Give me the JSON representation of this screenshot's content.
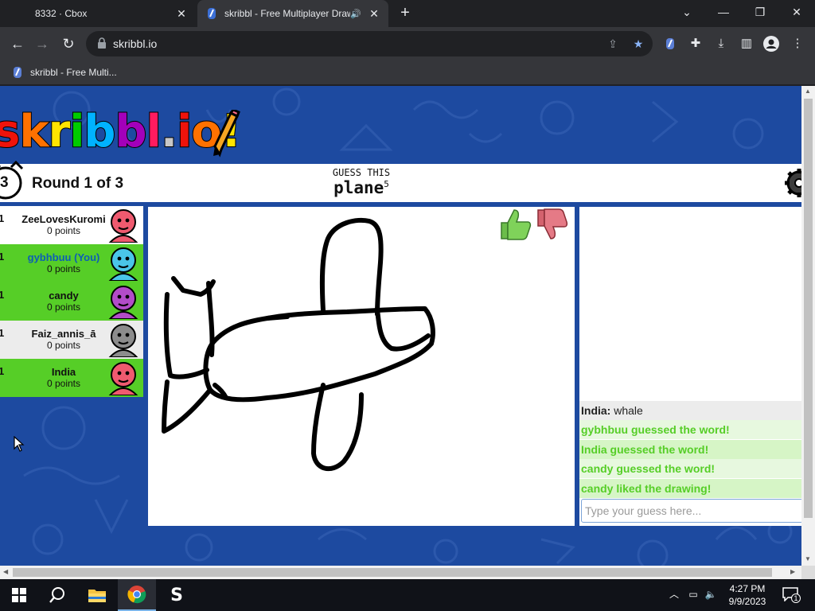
{
  "browser": {
    "tabs": [
      {
        "title": "8332 · Cbox",
        "active": false
      },
      {
        "title": "skribbl - Free Multiplayer Drawing",
        "active": true
      }
    ],
    "url": "skribbl.io",
    "bookmarks": [
      {
        "label": "skribbl - Free Multi..."
      }
    ]
  },
  "game": {
    "logo_letters": [
      "s",
      "k",
      "r",
      "i",
      "b",
      "b",
      "l",
      ".",
      "i",
      "o",
      "!"
    ],
    "logo_colors": [
      "#ef130b",
      "#ff7100",
      "#ffe400",
      "#00cc00",
      "#00b2ff",
      "#a300ba",
      "#ff1b5f",
      "#c7c7c7",
      "#ef130b",
      "#ff7100",
      "#ffe400"
    ],
    "timer": "3",
    "round_label": "Round 1 of 3",
    "guess_label": "GUESS THIS",
    "word": "plane",
    "word_length": "5"
  },
  "players": [
    {
      "rank": "1",
      "name": "ZeeLovesKuromi",
      "points": "0 points",
      "highlight": false,
      "bg": "#ffffff",
      "avatar_color": "#ef5a6f"
    },
    {
      "rank": "1",
      "name": "gybhbuu (You)",
      "points": "0 points",
      "highlight": true,
      "bg": "#56ce27",
      "avatar_color": "#4ac5e8"
    },
    {
      "rank": "1",
      "name": "candy",
      "points": "0 points",
      "highlight": true,
      "bg": "#56ce27",
      "avatar_color": "#b24cc8"
    },
    {
      "rank": "1",
      "name": "Faiz_annis_ā",
      "points": "0 points",
      "highlight": false,
      "bg": "#ececec",
      "avatar_color": "#8c8c8c"
    },
    {
      "rank": "1",
      "name": "India",
      "points": "0 points",
      "highlight": true,
      "bg": "#56ce27",
      "avatar_color": "#ef5a6f"
    }
  ],
  "chat": {
    "messages": [
      {
        "type": "plain",
        "author": "India:",
        "text": " whale"
      },
      {
        "type": "success",
        "author": "",
        "text": "gybhbuu guessed the word!"
      },
      {
        "type": "success",
        "author": "",
        "text": "India guessed the word!"
      },
      {
        "type": "success",
        "author": "",
        "text": "candy guessed the word!"
      },
      {
        "type": "success",
        "author": "",
        "text": "candy liked the drawing!"
      }
    ],
    "input_placeholder": "Type your guess here..."
  },
  "taskbar": {
    "time": "4:27 PM",
    "date": "9/9/2023",
    "notification_count": "1"
  },
  "colors": {
    "green": "#56ce27",
    "page_bg": "#1d4aa0",
    "chrome_dark": "#202124",
    "chrome_toolbar": "#35363a"
  }
}
